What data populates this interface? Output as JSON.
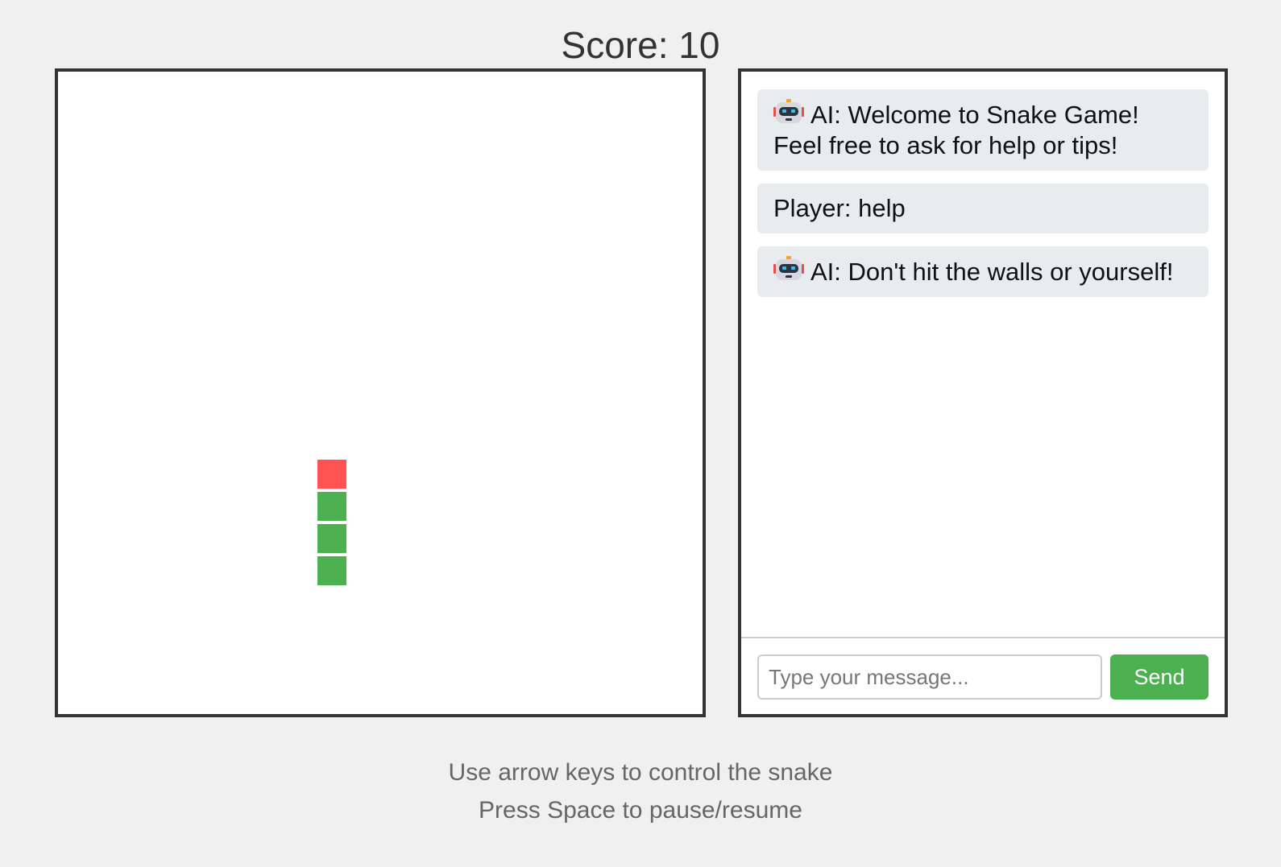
{
  "score": {
    "label": "Score: 10"
  },
  "game": {
    "grid_cells": 20,
    "food": {
      "col": 8,
      "row": 12,
      "color": "#ff5252"
    },
    "snake": {
      "color": "#4caf50",
      "segments": [
        {
          "col": 8,
          "row": 13
        },
        {
          "col": 8,
          "row": 14
        },
        {
          "col": 8,
          "row": 15
        }
      ]
    }
  },
  "chat": {
    "messages": [
      {
        "sender": "ai",
        "icon": "robot-icon",
        "text": "AI: Welcome to Snake Game! Feel free to ask for help or tips!"
      },
      {
        "sender": "player",
        "text": "Player: help"
      },
      {
        "sender": "ai",
        "icon": "robot-icon",
        "text": "AI: Don't hit the walls or yourself!"
      }
    ],
    "input_placeholder": "Type your message...",
    "input_value": "",
    "send_label": "Send",
    "accent_color": "#4caf50"
  },
  "instructions": {
    "line1": "Use arrow keys to control the snake",
    "line2": "Press Space to pause/resume"
  }
}
